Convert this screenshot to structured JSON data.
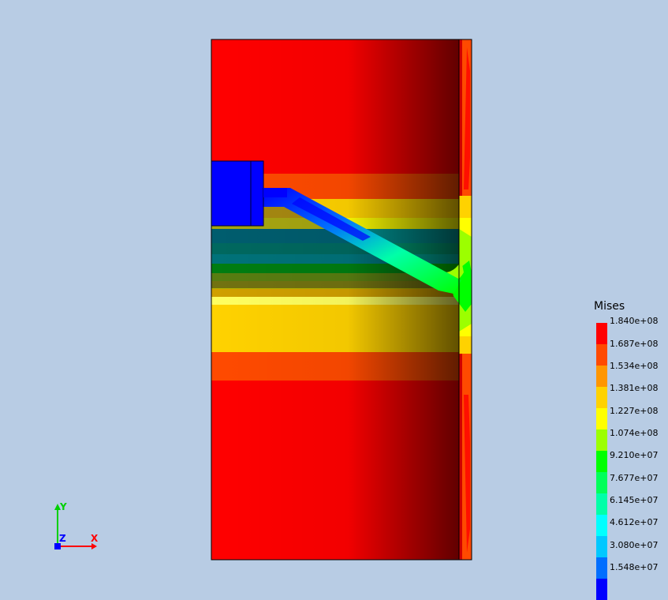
{
  "legend": {
    "title": "Mises",
    "ticks": [
      "1.840e+08",
      "1.687e+08",
      "1.534e+08",
      "1.381e+08",
      "1.227e+08",
      "1.074e+08",
      "9.210e+07",
      "7.677e+07",
      "6.145e+07",
      "4.612e+07",
      "3.080e+07",
      "1.548e+07"
    ],
    "colors": [
      "#ff0000",
      "#ff4a00",
      "#ff9600",
      "#ffd200",
      "#ffff00",
      "#9cff00",
      "#00ff00",
      "#00ff5a",
      "#00ffa8",
      "#00ffff",
      "#00c8ff",
      "#006eff",
      "#0000ff"
    ]
  },
  "triad": {
    "x_label": "X",
    "y_label": "Y",
    "z_label": "Z"
  }
}
